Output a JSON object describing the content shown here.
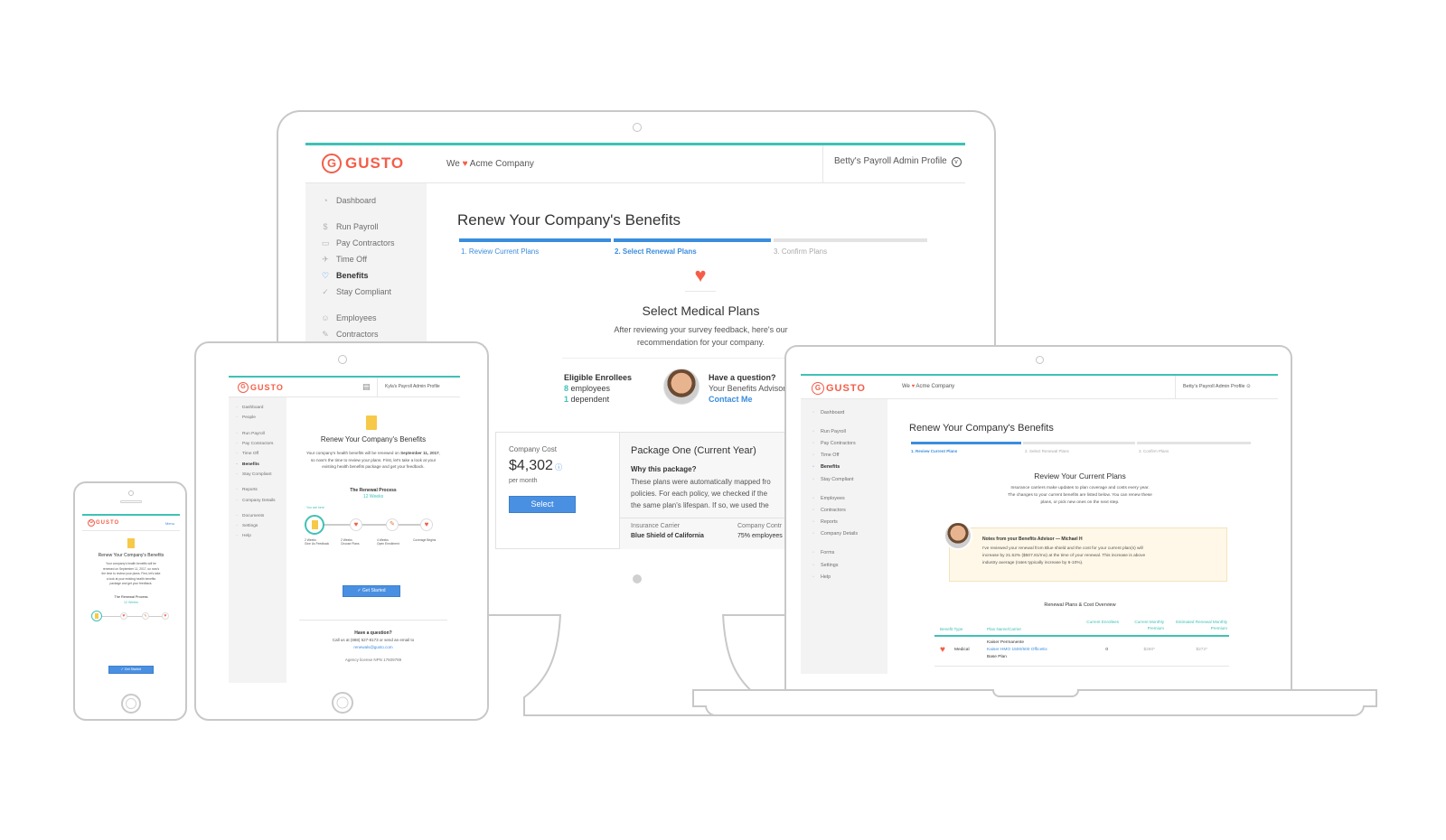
{
  "desktop": {
    "logo": "GUSTO",
    "tagline_we": "We",
    "company": "Acme Company",
    "profile": "Betty's Payroll Admin Profile",
    "nav": [
      {
        "label": "Dashboard",
        "icon": "dashboard-icon",
        "glyph": "◔"
      },
      {
        "label": "Run Payroll",
        "icon": "payroll-icon",
        "glyph": "$"
      },
      {
        "label": "Pay Contractors",
        "icon": "contractors-pay-icon",
        "glyph": "▭"
      },
      {
        "label": "Time Off",
        "icon": "time-off-icon",
        "glyph": "✈"
      },
      {
        "label": "Benefits",
        "icon": "benefits-icon",
        "glyph": "♡"
      },
      {
        "label": "Stay Compliant",
        "icon": "compliant-icon",
        "glyph": "✓"
      },
      {
        "label": "Employees",
        "icon": "employees-icon",
        "glyph": "☺"
      },
      {
        "label": "Contractors",
        "icon": "contractors-icon",
        "glyph": "✎"
      }
    ],
    "page_title": "Renew Your Company's Benefits",
    "steps": [
      "1. Review Current Plans",
      "2. Select Renewal Plans",
      "3. Confirm Plans"
    ],
    "section_title": "Select Medical Plans",
    "section_desc_1": "After reviewing your survey feedback, here's our",
    "section_desc_2": "recommendation for your company.",
    "eligible_title": "Eligible Enrollees",
    "employees_num": "8",
    "employees_label": "employees",
    "dependents_num": "1",
    "dependents_label": "dependent",
    "question_title": "Have a question?",
    "advisor_text": "Your Benefits Advisor",
    "contact_link": "Contact Me",
    "cost_label": "Company Cost",
    "cost_value": "$4,302",
    "cost_period": "per month",
    "select_button": "Select",
    "package_title": "Package One (Current Year)",
    "why_title": "Why this package?",
    "why_line_1": "These plans were automatically mapped fro",
    "why_line_2": "policies. For each policy, we checked if the",
    "why_line_3": "the same plan's lifespan. If so, we used the",
    "carrier_label": "Insurance Carrier",
    "carrier_value": "Blue Shield of California",
    "contrib_label": "Company Contr",
    "contrib_value": "75% employees"
  },
  "tablet": {
    "logo": "GUSTO",
    "profile": "Kyla's Payroll Admin Profile",
    "nav": [
      {
        "label": "Dashboard"
      },
      {
        "label": "People"
      },
      {
        "label": "Run Payroll"
      },
      {
        "label": "Pay Contractors"
      },
      {
        "label": "Time Off"
      },
      {
        "label": "Benefits"
      },
      {
        "label": "Stay Compliant"
      },
      {
        "label": "Reports"
      },
      {
        "label": "Company Details"
      },
      {
        "label": "Documents"
      },
      {
        "label": "Settings"
      },
      {
        "label": "Help"
      }
    ],
    "title": "Renew Your Company's Benefits",
    "intro_1": "Your company's health benefits will be renewed on",
    "intro_date": "September 11, 2017",
    "intro_2": ", so now's the time to review your plans.",
    "intro_3": "First, let's take a look at your existing health benefits",
    "intro_4": "package and get your feedback.",
    "process_title": "The Renewal Process",
    "process_weeks": "12 Weeks",
    "you_are_here": "You are here",
    "process_steps": [
      "2 Weeks\nGive Us Feedback",
      "2 Weeks\nChoose Plans",
      "4 Weeks\nOpen Enrollment",
      "Coverage Begins"
    ],
    "get_started": "✓ Get Started",
    "question": "Have a question?",
    "call_line": "Call us at (888) 527-8173 or send an email to",
    "email": "renewals@gusto.com",
    "license": "Agency license NPN 17609789"
  },
  "phone": {
    "logo": "GUSTO",
    "menu": "Menu",
    "title": "Renew Your Company's Benefits",
    "intro_1": "Your company's health benefits will be",
    "intro_2": "renewed on September 11, 2017, so now's",
    "intro_3": "the time to review your plans. First, let's take",
    "intro_4": "a look at your existing health benefits",
    "intro_5": "package and get your feedback.",
    "process_title": "The Renewal Process",
    "process_weeks": "12 Weeks",
    "get_started": "✓ Get Started"
  },
  "laptop": {
    "logo": "GUSTO",
    "tagline_we": "We",
    "company": "Acme Company",
    "profile": "Betty's Payroll Admin Profile",
    "nav": [
      {
        "label": "Dashboard"
      },
      {
        "label": "Run Payroll"
      },
      {
        "label": "Pay Contractors"
      },
      {
        "label": "Time Off"
      },
      {
        "label": "Benefits"
      },
      {
        "label": "Stay Compliant"
      },
      {
        "label": "Employees"
      },
      {
        "label": "Contractors"
      },
      {
        "label": "Reports"
      },
      {
        "label": "Company Details"
      },
      {
        "label": "Forms"
      },
      {
        "label": "Settings"
      },
      {
        "label": "Help"
      }
    ],
    "page_title": "Renew Your Company's Benefits",
    "steps": [
      "1. Review Current Plans",
      "2. Select Renewal Plans",
      "3. Confirm Plans"
    ],
    "section_title": "Review Your Current Plans",
    "desc_1": "Insurance carriers make updates to plan coverage and costs every year.",
    "desc_2": "The changes to your current benefits are listed below. You can renew these",
    "desc_3": "plans, or pick new ones on the next step.",
    "note_title": "Notes from your Benefits Advisor — Michael H",
    "note_1": "I've reviewed your renewal from Blue shield and the cost for your current plan(s) will",
    "note_2": "increase by 21.52% ($507.81/mo) at the time of your renewal. This increase is above",
    "note_3": "industry average (rates typically increase by 6-10%).",
    "table_title": "Renewal Plans & Cost Overview",
    "headers": [
      "Benefit Type",
      "Plan Name/Carrier",
      "Current Enrollees",
      "Current Monthly Premium",
      "Estimated Renewal Monthly Premium"
    ],
    "row": {
      "type": "Medical",
      "carrier": "Kaiser Permanente",
      "plan": "Kaiser HMO 1500/500 OfficeEx",
      "base": "Base Plan",
      "enrollees": "0",
      "current": "$260*",
      "renewal": "$272*"
    }
  }
}
